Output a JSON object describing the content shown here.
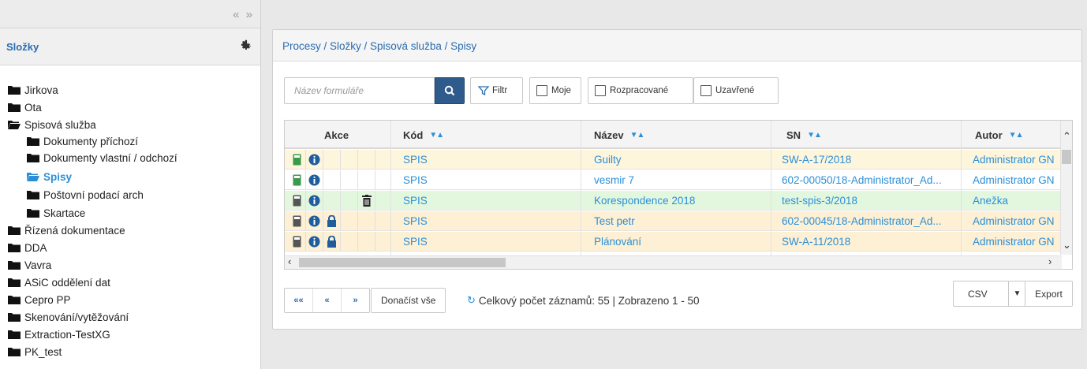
{
  "sidebar": {
    "collapse_label": "« »",
    "title": "Složky",
    "tree": [
      {
        "label": "Jirkova",
        "icon": "folder-closed-icon",
        "level": 0
      },
      {
        "label": "Ota",
        "icon": "folder-closed-icon",
        "level": 0
      },
      {
        "label": "Spisová služba",
        "icon": "folder-open-icon",
        "level": 0
      },
      {
        "label": "Dokumenty příchozí",
        "icon": "folder-closed-icon",
        "level": 1
      },
      {
        "label": "Dokumenty vlastní / odchozí",
        "icon": "folder-closed-icon",
        "level": 1
      },
      {
        "label": "Spisy",
        "icon": "folder-open-icon",
        "level": 1,
        "active": true
      },
      {
        "label": "Poštovní podací arch",
        "icon": "folder-closed-icon",
        "level": 1
      },
      {
        "label": "Skartace",
        "icon": "folder-closed-icon",
        "level": 1
      },
      {
        "label": "Řízená dokumentace",
        "icon": "folder-closed-icon",
        "level": 0
      },
      {
        "label": "DDA",
        "icon": "folder-closed-icon",
        "level": 0
      },
      {
        "label": "Vavra",
        "icon": "folder-closed-icon",
        "level": 0
      },
      {
        "label": "ASiC oddělení dat",
        "icon": "folder-closed-icon",
        "level": 0
      },
      {
        "label": "Cepro PP",
        "icon": "folder-closed-icon",
        "level": 0
      },
      {
        "label": "Skenování/vytěžování",
        "icon": "folder-closed-icon",
        "level": 0
      },
      {
        "label": "Extraction-TestXG",
        "icon": "folder-closed-icon",
        "level": 0
      },
      {
        "label": "PK_test",
        "icon": "folder-closed-icon",
        "level": 0
      }
    ]
  },
  "main": {
    "breadcrumb": "Procesy / Složky / Spisová služba / Spisy",
    "search_placeholder": "Název formuláře",
    "filter_label": "Filtr",
    "toggles": [
      "Moje",
      "Rozpracované",
      "Uzavřené"
    ],
    "columns": [
      "Akce",
      "Kód",
      "Název",
      "SN",
      "Autor"
    ],
    "rows": [
      {
        "code": "SPIS",
        "name": "Guilty",
        "sn": "SW-A-17/2018",
        "author": "Administrator GN",
        "bg": "#fdf5dc",
        "doc_color": "#3a9a4a",
        "lock": false,
        "trash": false
      },
      {
        "code": "SPIS",
        "name": "vesmir 7",
        "sn": "602-00050/18-Administrator_Ad...",
        "author": "Administrator GN",
        "bg": "#ffffff",
        "doc_color": "#3a9a4a",
        "lock": false,
        "trash": false
      },
      {
        "code": "SPIS",
        "name": "Korespondence 2018",
        "sn": "test-spis-3/2018",
        "author": "Anežka",
        "bg": "#e3f7de",
        "doc_color": "#555555",
        "lock": false,
        "trash": true
      },
      {
        "code": "SPIS",
        "name": "Test petr",
        "sn": "602-00045/18-Administrator_Ad...",
        "author": "Administrator GN",
        "bg": "#fdf0d4",
        "doc_color": "#555555",
        "lock": true,
        "trash": false
      },
      {
        "code": "SPIS",
        "name": "Plánování",
        "sn": "SW-A-11/2018",
        "author": "Administrator GN",
        "bg": "#fdf0d4",
        "doc_color": "#555555",
        "lock": true,
        "trash": false
      }
    ],
    "pager": [
      "««",
      "«",
      "»"
    ],
    "load_all": "Donačíst vše",
    "record_info": "Celkový počet záznamů: 55 | Zobrazeno 1 - 50",
    "export_format": "CSV",
    "export_label": "Export"
  },
  "colors": {
    "accent": "#2b8fd8",
    "search_button": "#2e5b8c",
    "info_icon": "#1f5d9c"
  }
}
